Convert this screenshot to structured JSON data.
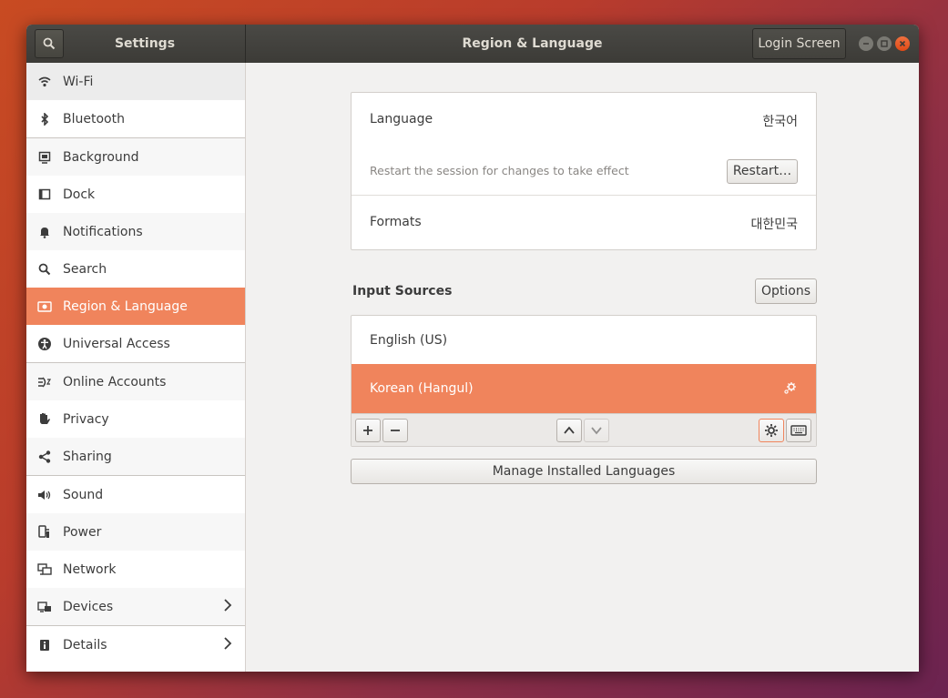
{
  "window": {
    "app_title": "Settings",
    "page_title": "Region & Language",
    "login_screen_label": "Login Screen"
  },
  "sidebar": {
    "items": [
      {
        "label": "Wi-Fi",
        "icon": "wifi-icon"
      },
      {
        "label": "Bluetooth",
        "icon": "bluetooth-icon"
      },
      {
        "label": "Background",
        "icon": "background-icon"
      },
      {
        "label": "Dock",
        "icon": "dock-icon"
      },
      {
        "label": "Notifications",
        "icon": "bell-icon"
      },
      {
        "label": "Search",
        "icon": "search-icon"
      },
      {
        "label": "Region & Language",
        "icon": "region-flag-icon",
        "selected": true
      },
      {
        "label": "Universal Access",
        "icon": "accessibility-icon"
      },
      {
        "label": "Online Accounts",
        "icon": "online-accounts-icon"
      },
      {
        "label": "Privacy",
        "icon": "hand-icon"
      },
      {
        "label": "Sharing",
        "icon": "share-icon"
      },
      {
        "label": "Sound",
        "icon": "speaker-icon"
      },
      {
        "label": "Power",
        "icon": "power-plug-icon"
      },
      {
        "label": "Network",
        "icon": "network-icon"
      },
      {
        "label": "Devices",
        "icon": "devices-icon"
      },
      {
        "label": "Details",
        "icon": "info-icon"
      }
    ]
  },
  "language_panel": {
    "language_label": "Language",
    "language_value": "한국어",
    "restart_hint": "Restart the session for changes to take effect",
    "restart_button": "Restart…",
    "formats_label": "Formats",
    "formats_value": "대한민국"
  },
  "input_sources": {
    "heading": "Input Sources",
    "options_button": "Options",
    "sources": [
      {
        "label": "English (US)",
        "selected": false
      },
      {
        "label": "Korean (Hangul)",
        "selected": true
      }
    ]
  },
  "manage_button": "Manage Installed Languages",
  "colors": {
    "accent": "#f0845c",
    "titlebar": "#3c3b37",
    "close": "#e95420"
  }
}
